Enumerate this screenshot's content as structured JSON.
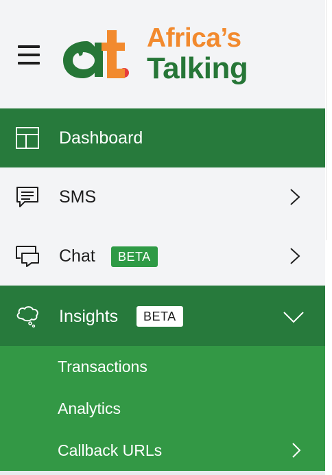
{
  "brand": {
    "name_line1": "Africa’s",
    "name_line2": "Talking",
    "orange": "#F28A2E",
    "green": "#267637",
    "red": "#E63B3B"
  },
  "header": {
    "menu_icon": "hamburger-icon"
  },
  "nav": {
    "items": [
      {
        "label": "Dashboard",
        "icon": "dashboard-layout-icon",
        "active": true
      },
      {
        "label": "SMS",
        "icon": "message-square-icon",
        "chevron": "chevron-right-icon"
      },
      {
        "label": "Chat",
        "icon": "chat-bubbles-icon",
        "badge": "BETA",
        "chevron": "chevron-right-icon"
      },
      {
        "label": "Insights",
        "icon": "thought-cloud-icon",
        "badge": "BETA",
        "chevron": "chevron-down-icon",
        "expanded": true
      }
    ],
    "insights_sub": [
      {
        "label": "Transactions"
      },
      {
        "label": "Analytics"
      },
      {
        "label": "Callback URLs",
        "chevron": "chevron-right-icon"
      }
    ]
  },
  "colors": {
    "active_bg": "#277A3C",
    "submenu_bg": "#339845",
    "sidebar_bg": "#F3F4F6",
    "badge_green": "#2E9A45"
  }
}
